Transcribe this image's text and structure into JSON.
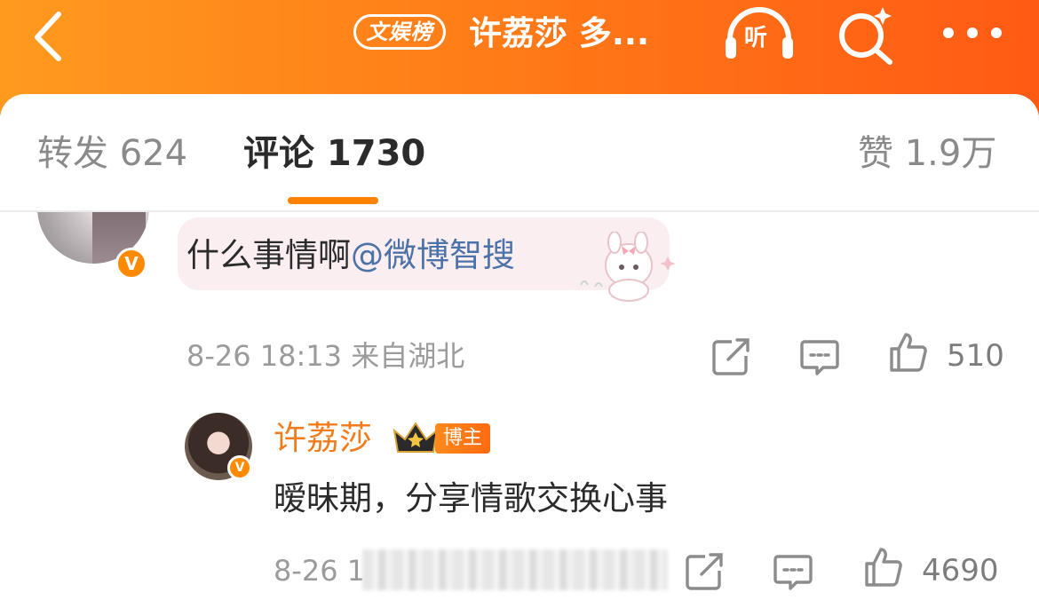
{
  "header": {
    "back_icon": "chevron-left-icon",
    "hot_badge": "文娱榜",
    "title": "许荔莎 多...",
    "listen_label": "听",
    "listen_icon": "headphones-icon",
    "search_icon": "search-sparkle-icon",
    "more_icon": "more-dots-icon",
    "gradient_colors": [
      "#ff9a1f",
      "#ff5a14"
    ]
  },
  "tabs": [
    {
      "label": "转发 624",
      "active": false
    },
    {
      "label": "评论 1730",
      "active": true
    },
    {
      "label": "赞 1.9万",
      "active": false
    }
  ],
  "accent_color": "#ff8200",
  "comments": [
    {
      "avatar": "user-avatar",
      "verified_label": "V",
      "text_before": "什么事情啊",
      "mention": "@微博智搜",
      "sticker": "pink-bunny-sticker",
      "time_location": "8-26 18:13 来自湖北",
      "share_icon": "share-icon",
      "reply_icon": "comment-icon",
      "like_icon": "thumbs-up-icon",
      "likes": "510"
    },
    {
      "author": "许荔莎",
      "author_badge_icon": "crown-icon",
      "host_badge": "博主",
      "verified_label": "V",
      "text": "暧昧期，分享情歌交换心事",
      "time_partial": "8-26 1",
      "share_icon": "share-icon",
      "reply_icon": "comment-icon",
      "like_icon": "thumbs-up-icon",
      "likes": "4690"
    }
  ]
}
